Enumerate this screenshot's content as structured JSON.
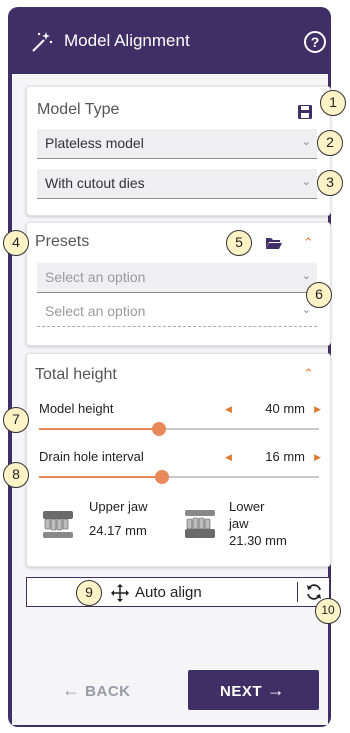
{
  "header": {
    "title": "Model Alignment",
    "help_glyph": "?"
  },
  "model_type": {
    "title": "Model Type",
    "model_select": "Plateless model",
    "dies_select": "With cutout dies"
  },
  "presets": {
    "title": "Presets",
    "select_placeholder_1": "Select an option",
    "select_placeholder_2": "Select an option"
  },
  "total_height": {
    "title": "Total height",
    "model_height": {
      "label": "Model height",
      "value": "40 mm",
      "fraction": 0.43
    },
    "drain_hole": {
      "label": "Drain hole interval",
      "value": "16 mm",
      "fraction": 0.44
    },
    "upper_jaw": {
      "label": "Upper jaw",
      "value": "24.17 mm"
    },
    "lower_jaw": {
      "label_line1": "Lower",
      "label_line2": "jaw",
      "value": "21.30 mm"
    }
  },
  "actions": {
    "auto_align": "Auto align",
    "back": "BACK",
    "next": "NEXT"
  },
  "markers": [
    "1",
    "2",
    "3",
    "4",
    "5",
    "6",
    "7",
    "8",
    "9",
    "10"
  ],
  "colors": {
    "brand": "#3f2f66",
    "accent": "#e07b39",
    "marker_bg": "#fdf3c7"
  }
}
